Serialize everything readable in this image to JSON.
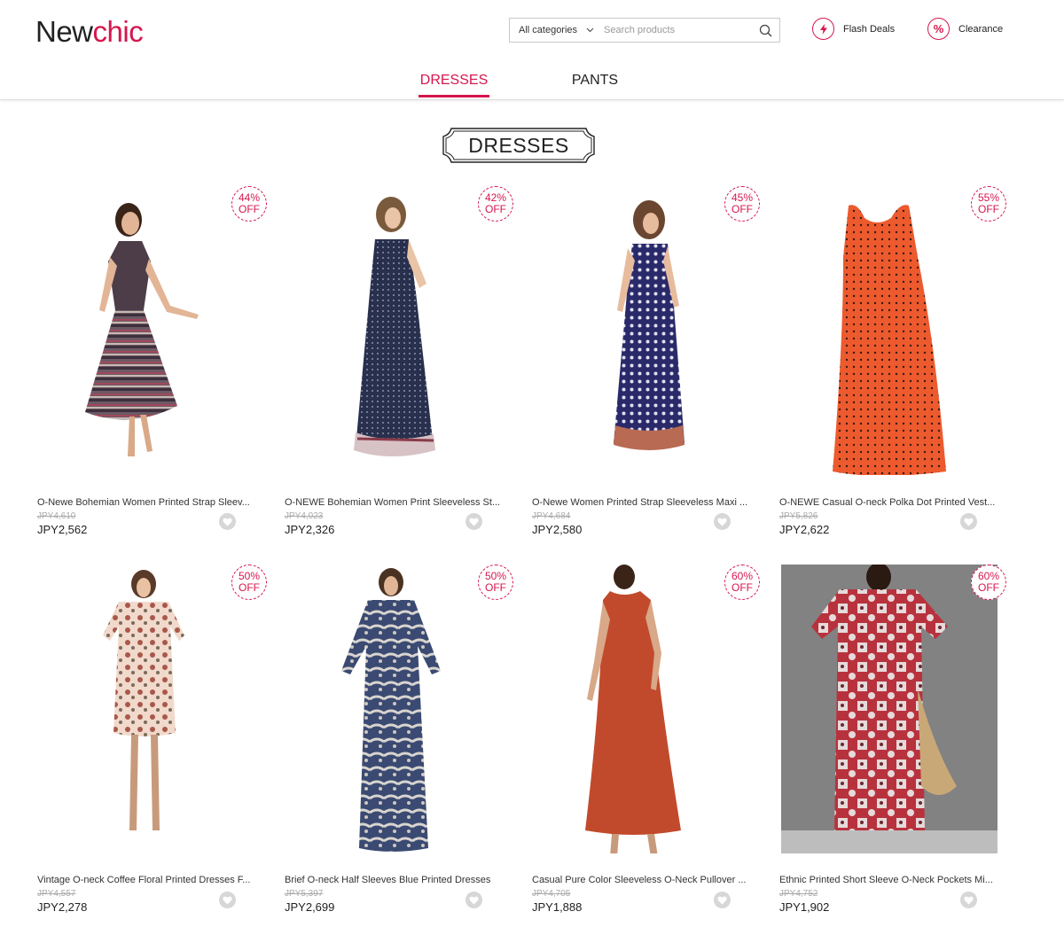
{
  "header": {
    "logo_part1": "New",
    "logo_part2": "chic",
    "search": {
      "category": "All categories",
      "placeholder": "Search products"
    },
    "links": [
      {
        "label": "Flash Deals"
      },
      {
        "label": "Clearance"
      }
    ]
  },
  "tabs": [
    {
      "label": "DRESSES",
      "active": true
    },
    {
      "label": "PANTS",
      "active": false
    }
  ],
  "section_title": "DRESSES",
  "products": [
    {
      "name": "O-Newe Bohemian Women Printed Strap Sleev...",
      "discount": "44%",
      "off": "OFF",
      "old_price": "JPY4,610",
      "price": "JPY2,562"
    },
    {
      "name": "O-NEWE Bohemian Women Print Sleeveless St...",
      "discount": "42%",
      "off": "OFF",
      "old_price": "JPY4,023",
      "price": "JPY2,326"
    },
    {
      "name": "O-Newe Women Printed Strap Sleeveless Maxi ...",
      "discount": "45%",
      "off": "OFF",
      "old_price": "JPY4,684",
      "price": "JPY2,580"
    },
    {
      "name": "O-NEWE Casual O-neck Polka Dot Printed Vest...",
      "discount": "55%",
      "off": "OFF",
      "old_price": "JPY5,826",
      "price": "JPY2,622"
    },
    {
      "name": "Vintage O-neck Coffee Floral Printed Dresses F...",
      "discount": "50%",
      "off": "OFF",
      "old_price": "JPY4,557",
      "price": "JPY2,278"
    },
    {
      "name": "Brief O-neck Half Sleeves Blue Printed Dresses",
      "discount": "50%",
      "off": "OFF",
      "old_price": "JPY5,397",
      "price": "JPY2,699"
    },
    {
      "name": "Casual Pure Color Sleeveless O-Neck Pullover ...",
      "discount": "60%",
      "off": "OFF",
      "old_price": "JPY4,705",
      "price": "JPY1,888"
    },
    {
      "name": "Ethnic Printed Short Sleeve O-Neck Pockets Mi...",
      "discount": "60%",
      "off": "OFF",
      "old_price": "JPY4,752",
      "price": "JPY1,902"
    }
  ],
  "colors": {
    "brand": "#d6164e"
  }
}
